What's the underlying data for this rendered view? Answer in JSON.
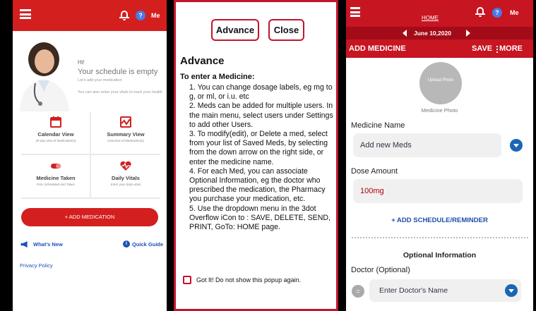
{
  "screen1": {
    "me": "Me",
    "help": "?",
    "greeting": "Hi!",
    "empty_title": "Your schedule is empty",
    "empty_sub": "Let's add your medication",
    "vitals_hint": "You can also enter your vitals to track your health",
    "tiles": [
      {
        "title": "Calendar View",
        "sub": "30 day view of Medication(s)"
      },
      {
        "title": "Summary View",
        "sub": "Overview of Medication(s)"
      },
      {
        "title": "Medicine Taken",
        "sub": "Prior Scheduled and Taken"
      },
      {
        "title": "Daily Vitals",
        "sub": "Enter your daily vitals"
      }
    ],
    "add_medication": "+ ADD MEDICATION",
    "whats_new": "What's New",
    "quick_guide": "Quick Guide",
    "quick_guide_icon": "i",
    "privacy": "Privacy Policy"
  },
  "screen2": {
    "advance_button": "Advance",
    "close_button": "Close",
    "heading": "Advance",
    "subheading": "To enter a Medicine:",
    "items": [
      "1. You can change dosage labels, eg mg to g, or ml, or i.u. etc",
      "2. Meds can be added for multiple users. In the main menu, select users under Settings to add other Users.",
      "3. To modify(edit), or Delete a med, select from your list of Saved Meds, by selecting from the down arrow on the right side, or enter the medicine name.",
      "4. For each Med, you can associate Optional Information, eg the doctor who prescribed the medication, the Pharmacy you purchase your medication, etc.",
      "5. Use the dropdown menu in the 3dot Overflow iCon to : SAVE, DELETE, SEND, PRINT, GoTo: HOME page."
    ],
    "checkbox_label": "Got It!  Do not show this popup again."
  },
  "screen3": {
    "home": "HOME",
    "me": "Me",
    "help": "?",
    "date": "June 10,2020",
    "title": "ADD MEDICINE",
    "save": "SAVE",
    "more": "MORE",
    "upload_photo": "Upload Photo",
    "photo_label": "Medicine Photo",
    "medicine_name_label": "Medicine Name",
    "medicine_name_value": "Add new Meds",
    "dose_label": "Dose Amount",
    "dose_value": "100mg",
    "add_schedule": "+ ADD SCHEDULE/REMINDER",
    "optional_info": "Optional Information",
    "doctor_label": "Doctor (Optional)",
    "doctor_placeholder": "Enter Doctor's Name",
    "doctor_icon_glyph": "="
  },
  "colors": {
    "brand_red": "#d41f1f",
    "link_blue": "#1a52b8",
    "dropdown_blue": "#1a66b5",
    "border_red": "#c0162c"
  }
}
